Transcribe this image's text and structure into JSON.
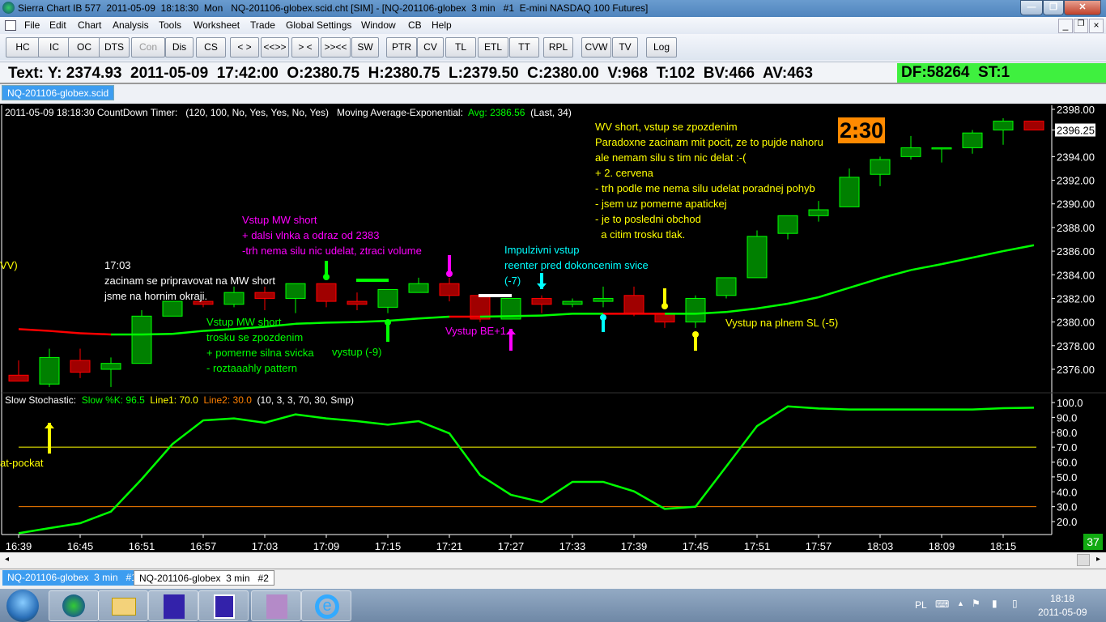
{
  "window": {
    "title": "Sierra Chart IB 577  2011-05-09  18:18:30  Mon   NQ-201106-globex.scid.cht [SIM] - [NQ-201106-globex  3 min   #1  E-mini NASDAQ 100 Futures]"
  },
  "menu": [
    "File",
    "Edit",
    "Chart",
    "Analysis",
    "Tools",
    "Worksheet",
    "Trade",
    "Global Settings",
    "Window",
    "CB",
    "Help"
  ],
  "toolbar": [
    "HC",
    "IC",
    "OC",
    "DTS",
    "Con",
    "Dis",
    "CS",
    "< >",
    "<<>>",
    "> <",
    ">><<",
    "SW",
    "PTR",
    "CV",
    "TL",
    "ETL",
    "TT",
    "RPL",
    "CVW",
    "TV",
    "Log"
  ],
  "infobar": {
    "text": "Text: Y: 2374.93  2011-05-09  17:42:00  O:2380.75  H:2380.75  L:2379.50  C:2380.00  V:968  T:102  BV:466  AV:463",
    "df": "DF:58264  ST:1"
  },
  "chart_tab": "NQ-201106-globex.scid",
  "chart_header": {
    "prefix": "2011-05-09 18:18:30 CountDown Timer:   (120, 100, No, Yes, Yes, No, Yes)   Moving Average-Exponential:  ",
    "avg": "Avg: 2386.56",
    "suffix": "  (Last, 34)"
  },
  "timer": "2:30",
  "stoch_header": {
    "label": "Slow Stochastic:  ",
    "k": "Slow %K: 96.5",
    "line1": "  Line1: 70.0",
    "line2": "  Line2: 30.0",
    "params": "  (10, 3, 3, 70, 30, Smp)"
  },
  "annotations": {
    "white_1703": "17:03\nzacinam se pripravovat na MW short\njsme na hornim okraji.",
    "magenta_entry": "Vstup MW short\n+ dalsi vlnka a odraz od 2383\n-trh nema silu nic udelat, ztraci volume",
    "green_entry": "Vstup MW short\ntrosku se zpozdenim\n+ pomerne silna svicka\n- roztaaahly pattern",
    "green_exit": "vystup (-9)",
    "magenta_exit": "Vystup BE+1",
    "cyan_entry": "Impulzivni vstup\nreenter pred dokoncenim svice\n(-7)",
    "yellow_entry": "WV short, vstup se zpozdenim\nParadoxne zacinam mit pocit, ze to pujde nahoru\nale nemam silu s tim nic delat :-(\n+ 2. cervena\n- trh podle me nema silu udelat poradnej pohyb\n- jsem uz pomerne apatickej\n- je to posledni obchod\n  a citim trosku tlak.",
    "yellow_exit": "Vystup na plnem SL (-5)",
    "yellow_cut_left": "VV)",
    "yellow_cut_stoch": "at-pockat"
  },
  "colors": {
    "up": "#008000",
    "up_border": "#00ff00",
    "down": "#a00000",
    "down_border": "#ff0000",
    "ma": "#00ff00",
    "ma_down": "#ff0000",
    "line1": "#ffff00",
    "line2": "#ff8000",
    "stoch": "#00ff00",
    "timer": "#ff8a00",
    "df": "#3ff03f"
  },
  "chart_data": [
    {
      "type": "candlestick",
      "title": "NQ-201106-globex 3 min",
      "ylim": [
        2374,
        2399
      ],
      "categories": [
        "16:39",
        "16:42",
        "16:45",
        "16:48",
        "16:51",
        "16:54",
        "16:57",
        "17:00",
        "17:03",
        "17:06",
        "17:09",
        "17:12",
        "17:15",
        "17:18",
        "17:21",
        "17:24",
        "17:27",
        "17:30",
        "17:33",
        "17:36",
        "17:39",
        "17:42",
        "17:45",
        "17:48",
        "17:51",
        "17:54",
        "17:57",
        "18:00",
        "18:03",
        "18:06",
        "18:09",
        "18:12",
        "18:15",
        "18:18"
      ],
      "ohlc": [
        [
          2375.5,
          2376.75,
          2375,
          2375
        ],
        [
          2374.75,
          2377.75,
          2374.5,
          2377
        ],
        [
          2376.75,
          2377.75,
          2375.25,
          2375.75
        ],
        [
          2376,
          2377,
          2374.5,
          2376.5
        ],
        [
          2376.5,
          2381,
          2376.5,
          2380.5
        ],
        [
          2380.5,
          2381.75,
          2380.5,
          2381.75
        ],
        [
          2381.75,
          2381.75,
          2381.25,
          2381.5
        ],
        [
          2381.5,
          2383,
          2381.25,
          2382.5
        ],
        [
          2382.5,
          2383,
          2381,
          2382
        ],
        [
          2382,
          2383.25,
          2380.75,
          2383.25
        ],
        [
          2383.25,
          2383.25,
          2381.25,
          2381.75
        ],
        [
          2381.75,
          2382.5,
          2381,
          2381.5
        ],
        [
          2381.25,
          2382.75,
          2380.75,
          2382.75
        ],
        [
          2382.5,
          2383.75,
          2382.5,
          2383.25
        ],
        [
          2383.25,
          2383.75,
          2381.75,
          2382.25
        ],
        [
          2382.25,
          2382.25,
          2380,
          2380.25
        ],
        [
          2380.25,
          2382,
          2380.25,
          2382
        ],
        [
          2382,
          2382.25,
          2380.75,
          2381.5
        ],
        [
          2381.5,
          2382,
          2381.25,
          2381.75
        ],
        [
          2381.75,
          2383,
          2381.25,
          2382
        ],
        [
          2382.25,
          2383,
          2380.5,
          2380.75
        ],
        [
          2380.75,
          2380.75,
          2379.5,
          2380
        ],
        [
          2380,
          2382.25,
          2379.5,
          2382
        ],
        [
          2382.25,
          2383.75,
          2382,
          2383.75
        ],
        [
          2383.75,
          2387.75,
          2383.75,
          2387.25
        ],
        [
          2387.5,
          2389,
          2387,
          2389
        ],
        [
          2389,
          2390.25,
          2388.5,
          2389.5
        ],
        [
          2389.75,
          2393,
          2389.75,
          2392.25
        ],
        [
          2392.5,
          2394,
          2391.5,
          2393.75
        ],
        [
          2394,
          2395.75,
          2393.75,
          2394.75
        ],
        [
          2394.75,
          2394.75,
          2393.5,
          2394.75
        ],
        [
          2394.75,
          2396.25,
          2394.25,
          2396
        ],
        [
          2396.25,
          2397.25,
          2395,
          2397
        ],
        [
          2397,
          2397,
          2396.25,
          2396.25
        ]
      ],
      "ema34": [
        2379.4,
        2379.25,
        2379.05,
        2378.95,
        2378.95,
        2379.0,
        2379.25,
        2379.4,
        2379.6,
        2379.85,
        2379.95,
        2380.0,
        2380.1,
        2380.3,
        2380.45,
        2380.45,
        2380.5,
        2380.55,
        2380.7,
        2380.7,
        2380.7,
        2380.7,
        2380.7,
        2380.85,
        2381.15,
        2381.55,
        2382.1,
        2382.9,
        2383.7,
        2384.4,
        2384.9,
        2385.45,
        2386.0,
        2386.5
      ],
      "ema_down_segments": [
        0,
        1,
        2,
        14,
        19,
        20
      ],
      "yticks": [
        "2398.00",
        "2396.25",
        "2394.00",
        "2392.00",
        "2390.00",
        "2388.00",
        "2386.00",
        "2384.00",
        "2382.00",
        "2380.00",
        "2378.00",
        "2376.00"
      ],
      "ytick_values": [
        2398,
        2396.25,
        2394,
        2392,
        2390,
        2388,
        2386,
        2384,
        2382,
        2380,
        2378,
        2376
      ],
      "current_price": "2396.25"
    },
    {
      "type": "line",
      "title": "Slow Stochastic",
      "ylim": [
        12,
        104
      ],
      "k": [
        12.2,
        15.6,
        18.9,
        26.7,
        48.5,
        72.1,
        88.0,
        89.3,
        86.4,
        92.0,
        89.3,
        87.5,
        85.1,
        87.5,
        79.3,
        51.2,
        38.0,
        33.1,
        46.7,
        46.7,
        40.3,
        28.5,
        30.0,
        57.0,
        84.2,
        97.4,
        96.0,
        95.3,
        95.3,
        95.3,
        95.3,
        95.3,
        96.2,
        96.5
      ],
      "line1": 70,
      "line2": 30,
      "yticks": [
        "100.0",
        "90.0",
        "80.0",
        "70.0",
        "60.0",
        "50.0",
        "40.0",
        "30.0",
        "20.0"
      ],
      "ytick_values": [
        100,
        90,
        80,
        70,
        60,
        50,
        40,
        30,
        20
      ],
      "xticks": [
        "16:39",
        "16:45",
        "16:51",
        "16:57",
        "17:03",
        "17:09",
        "17:15",
        "17:21",
        "17:27",
        "17:33",
        "17:39",
        "17:45",
        "17:51",
        "17:57",
        "18:03",
        "18:09",
        "18:15"
      ]
    }
  ],
  "bars_badge": "37",
  "bottom_tabs": [
    "NQ-201106-globex  3 min   #1",
    "NQ-201106-globex  3 min   #2"
  ],
  "tray": {
    "lang": "PL",
    "time": "18:18",
    "date": "2011-05-09"
  }
}
